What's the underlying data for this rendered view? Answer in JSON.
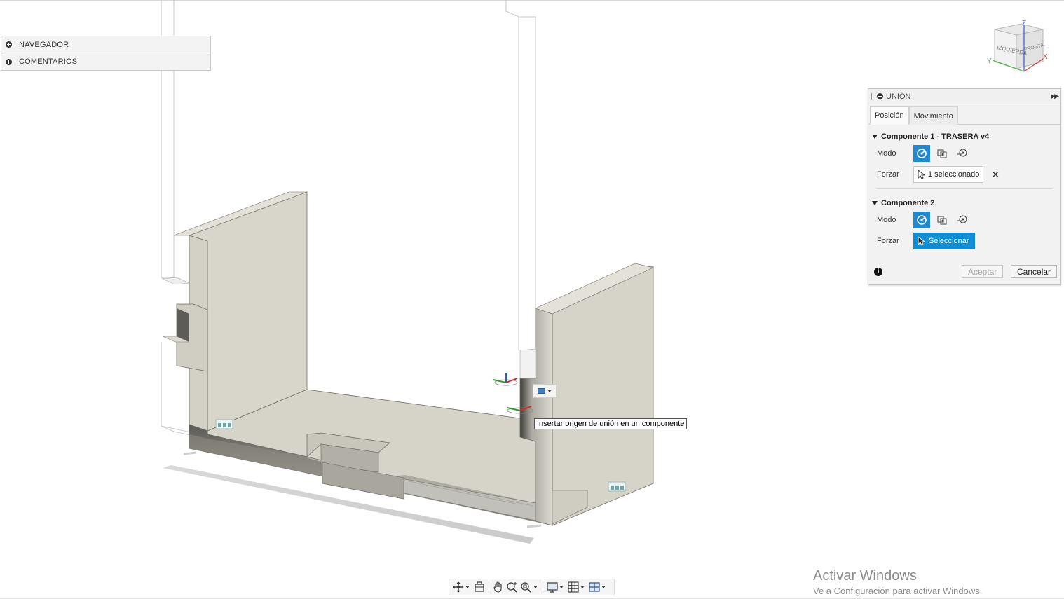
{
  "browser": {
    "items": [
      {
        "label": "NAVEGADOR"
      },
      {
        "label": "COMENTARIOS"
      }
    ]
  },
  "viewcube": {
    "axis_z": "Z",
    "axis_x": "X",
    "axis_y": "Y",
    "face_left": "IZQUIERDA",
    "face_front": "FRONTAL"
  },
  "tooltip": {
    "text": "Insertar origen de unión en un componente"
  },
  "dialog": {
    "title": "UNIÓN",
    "tabs": [
      {
        "label": "Posición",
        "active": true
      },
      {
        "label": "Movimiento",
        "active": false
      }
    ],
    "component1": {
      "title": "Componente 1 - TRASERA v4",
      "mode_label": "Modo",
      "snap_label": "Forzar",
      "snap_value": "1 seleccionado"
    },
    "component2": {
      "title": "Componente 2",
      "mode_label": "Modo",
      "snap_label": "Forzar",
      "snap_value": "Seleccionar"
    },
    "ok_label": "Aceptar",
    "cancel_label": "Cancelar"
  },
  "watermark": {
    "title": "Activar Windows",
    "subtitle": "Ve a Configuración para activar Windows."
  },
  "colors": {
    "accent": "#0f8ed6",
    "part_face": "#d6d4c8",
    "part_shadow": "#8f8d84"
  }
}
